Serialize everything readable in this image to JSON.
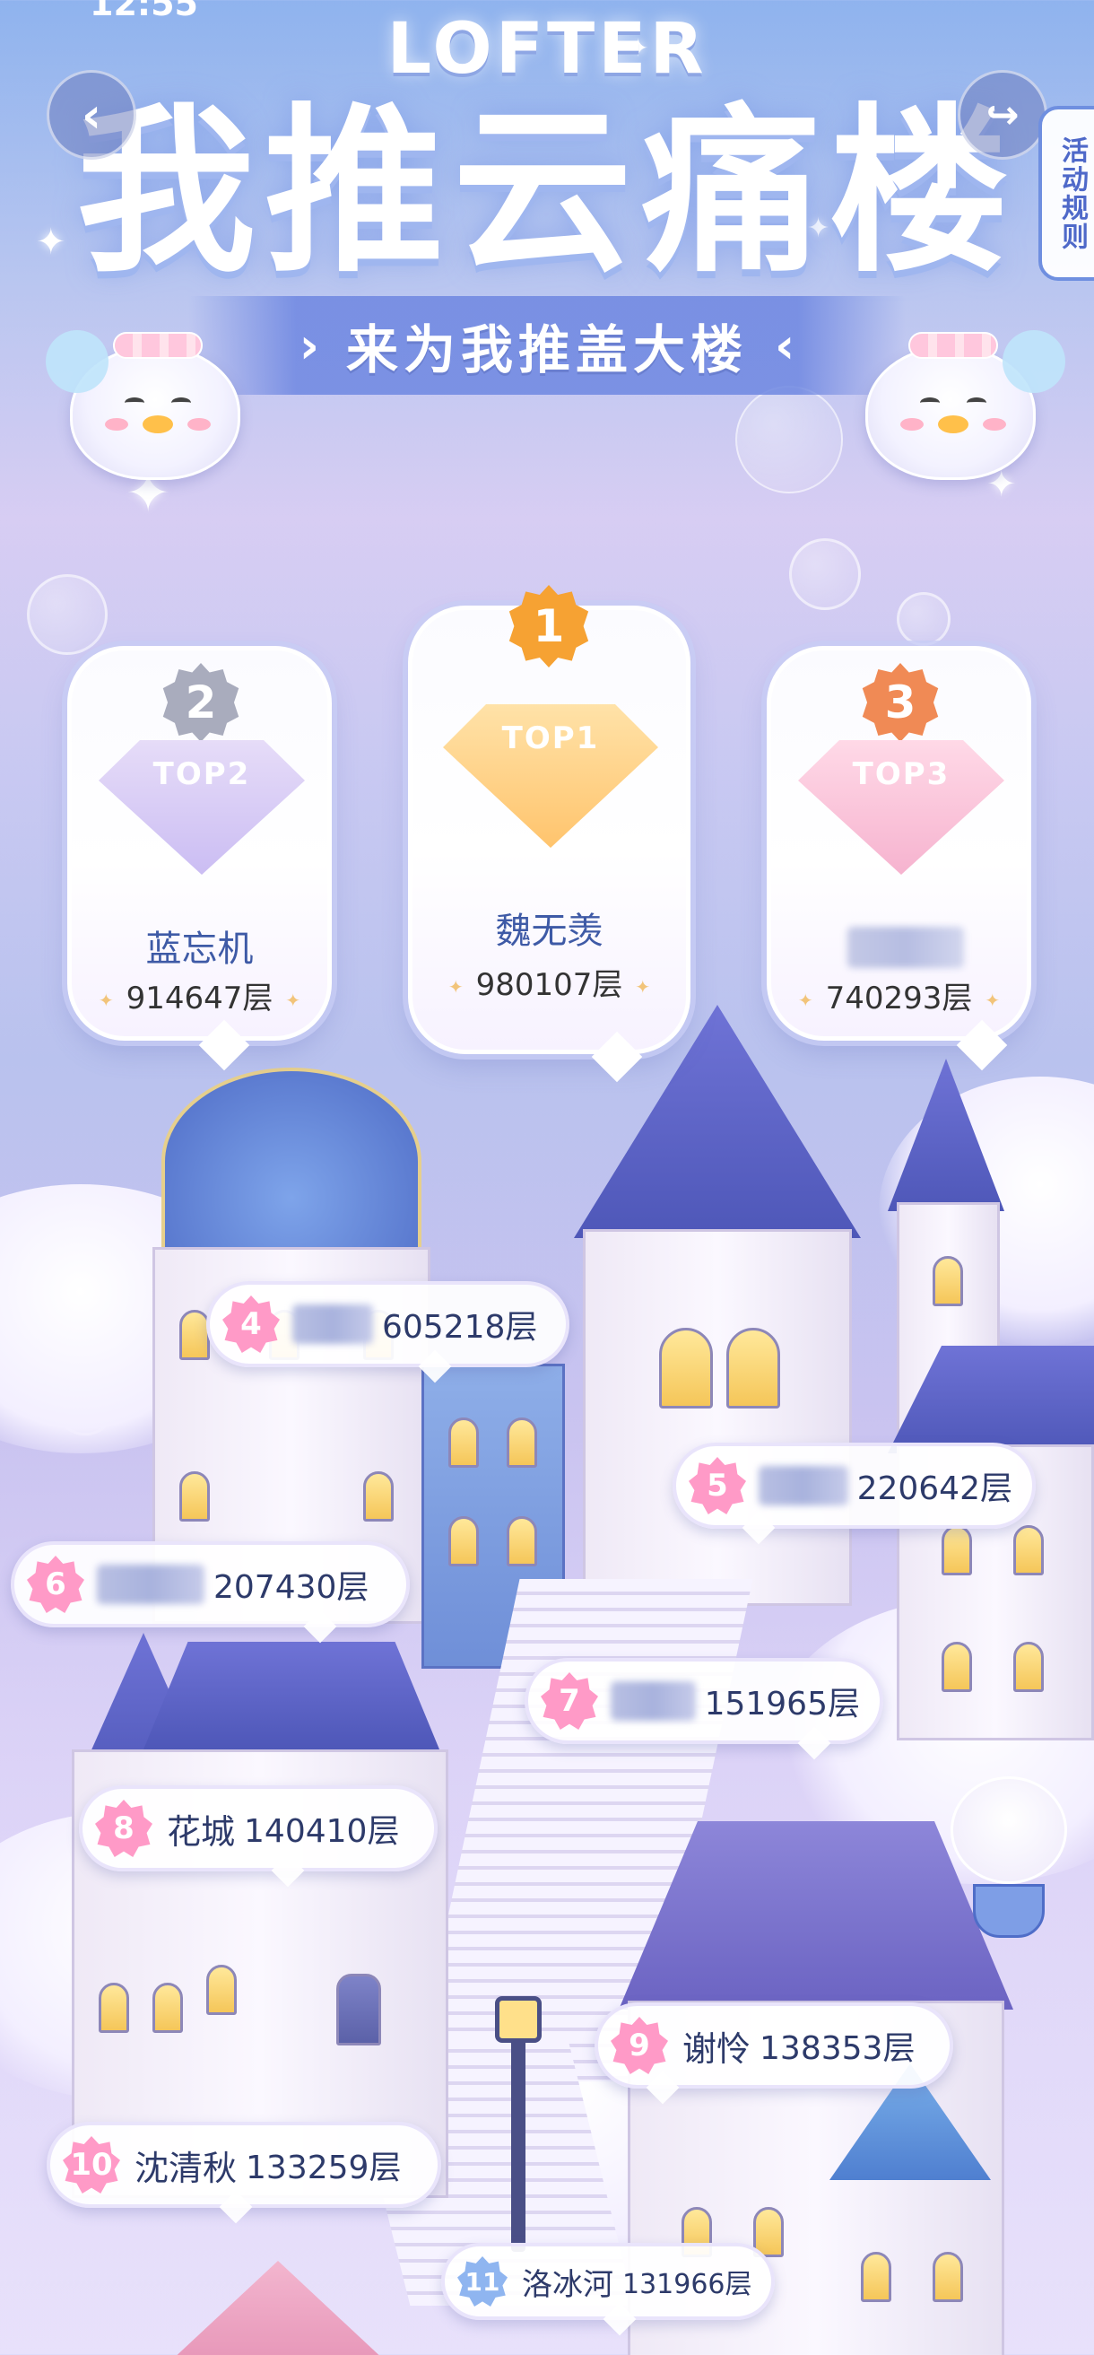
{
  "status_bar": {
    "time": "12:55"
  },
  "header": {
    "brand": "LOFTER",
    "title": "我推云痛楼",
    "subtitle": "来为我推盖大楼",
    "back_glyph": "‹",
    "share_glyph": "↪",
    "rules_label": "活动规则"
  },
  "podium": [
    {
      "rank": "1",
      "badge_text": "TOP1",
      "name": "魏无羡",
      "floors": "980107层",
      "medal_color": "#f6a233"
    },
    {
      "rank": "2",
      "badge_text": "TOP2",
      "name": "蓝忘机",
      "floors": "914647层",
      "medal_color": "#a9acbd"
    },
    {
      "rank": "3",
      "badge_text": "TOP3",
      "name": "",
      "floors": "740293层",
      "medal_color": "#f08a55"
    }
  ],
  "ranks": [
    {
      "rank": "4",
      "name": "",
      "floors": "605218层"
    },
    {
      "rank": "5",
      "name": "",
      "floors": "220642层"
    },
    {
      "rank": "6",
      "name": "",
      "floors": "207430层"
    },
    {
      "rank": "7",
      "name": "",
      "floors": "151965层"
    },
    {
      "rank": "8",
      "name": "花城",
      "floors": "140410层"
    },
    {
      "rank": "9",
      "name": "谢怜",
      "floors": "138353层"
    },
    {
      "rank": "10",
      "name": "沈清秋",
      "floors": "133259层"
    },
    {
      "rank": "11",
      "name": "洛冰河",
      "floors": "131966层"
    }
  ],
  "icons": {
    "back": "back-arrow-icon",
    "share": "share-icon",
    "mascot": "duck-mascot-icon",
    "medal": "medal-icon",
    "badge": "rank-badge-icon"
  },
  "colors": {
    "accent": "#6f8fe0",
    "name_blue": "#3e5aa6",
    "rank_pink": "#ff9ac7",
    "rank_blue": "#8fb5f0"
  }
}
